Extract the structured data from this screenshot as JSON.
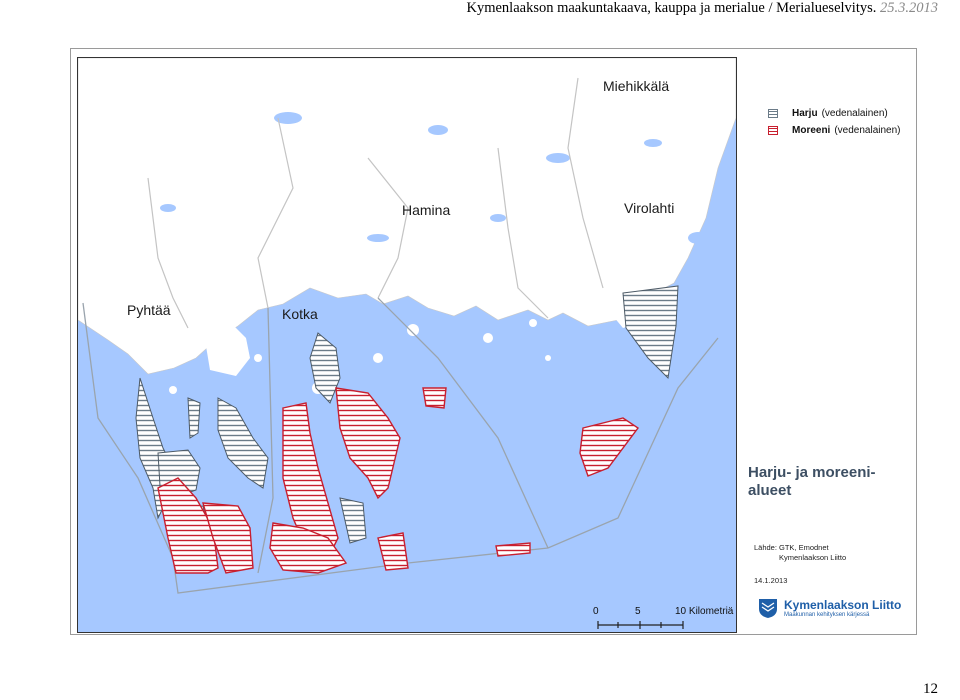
{
  "header": {
    "title": "Kymenlaakson maakuntakaava, kauppa ja merialue / Merialueselvitys.",
    "date": "25.3.2013"
  },
  "map": {
    "places": [
      "Miehikkälä",
      "Hamina",
      "Virolahti",
      "Pyhtää",
      "Kotka"
    ],
    "colors": {
      "sea": "#a6c8ff",
      "land": "#ffffff",
      "lake": "#a6c8ff",
      "harju": "#6b7b88",
      "moreeni": "#c81f2f"
    }
  },
  "legend": {
    "items": [
      {
        "name": "Harju",
        "qualifier": "(vedenalainen)",
        "color": "#6b7b88"
      },
      {
        "name": "Moreeni",
        "qualifier": "(vedenalainen)",
        "color": "#c81f2f"
      }
    ]
  },
  "map_title": {
    "line1": "Harju- ja moreeni-",
    "line2": "alueet"
  },
  "source": {
    "label": "Lähde:",
    "line1": "GTK, Emodnet",
    "line2": "Kymenlaakson Liitto",
    "date": "14.1.2013"
  },
  "logo": {
    "name": "Kymenlaakson Liitto",
    "slogan": "Maakunnan kehityksen kärjessä"
  },
  "scale": {
    "ticks": [
      "0",
      "5",
      "10 Kilometriä"
    ]
  },
  "page_number": "12"
}
